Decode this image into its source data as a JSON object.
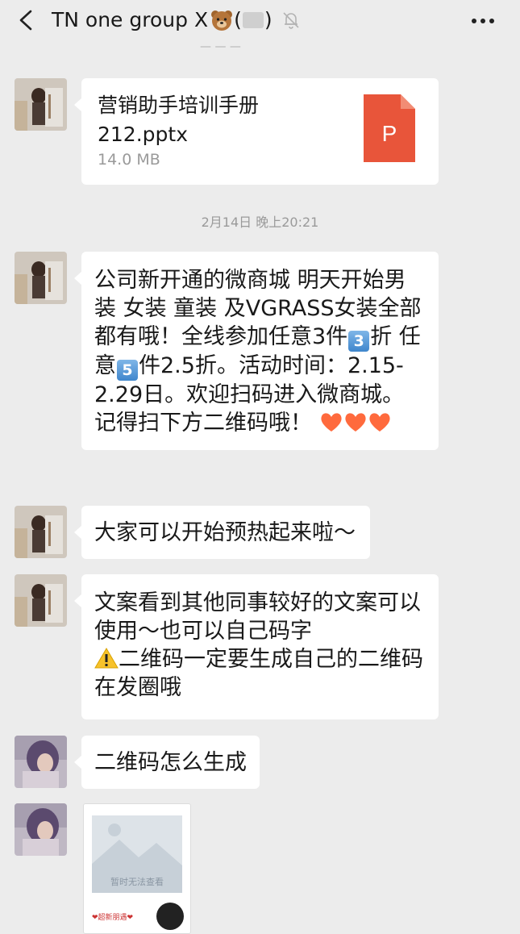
{
  "header": {
    "title": "TN one group X",
    "title_suffix_open": "(",
    "title_suffix_close": ")",
    "cut_off_text": "— — —"
  },
  "messages": [
    {
      "type": "file",
      "file_name": "营销助手培训手册 212.pptx",
      "file_size": "14.0 MB",
      "icon_letter": "P"
    },
    {
      "type": "timestamp",
      "text": "2月14日 晚上20:21"
    },
    {
      "type": "text",
      "text_parts": {
        "p1": "公司新开通的微商城 明天开始男装 女装 童装 及VGRASS女装全部都有哦！全线参加任意3件",
        "p2": "折 任意",
        "p3": "件2.5折。活动时间：2.15-2.29日。欢迎扫码进入微商城。记得扫下方二维码哦！"
      },
      "keycap1": "3",
      "keycap2": "5"
    },
    {
      "type": "text",
      "text": "大家可以开始预热起来啦～"
    },
    {
      "type": "text",
      "line1": "文案看到其他同事较好的文案可以使用～也可以自己码字",
      "line2": "二维码一定要生成自己的二维码在发圈哦"
    },
    {
      "type": "text",
      "text": "二维码怎么生成"
    },
    {
      "type": "image",
      "caption": "暂时无法查看",
      "footer": "❤超新朋遇❤"
    }
  ],
  "colors": {
    "background": "#ececec",
    "bubble": "#ffffff",
    "ppt_icon": "#e8553a",
    "heart": "#ff6a3d",
    "keycap": "#3f86cc"
  }
}
